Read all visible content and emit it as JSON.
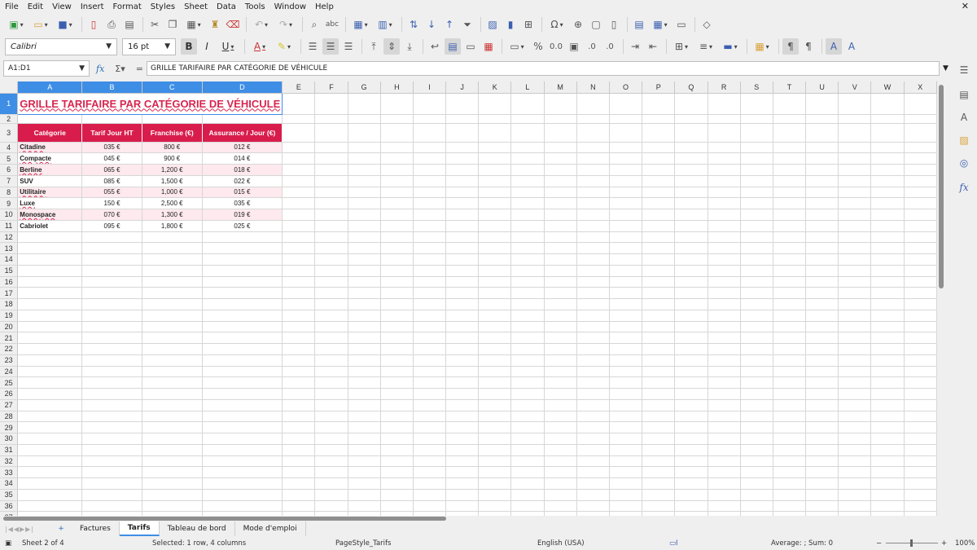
{
  "menu": [
    "File",
    "Edit",
    "View",
    "Insert",
    "Format",
    "Styles",
    "Sheet",
    "Data",
    "Tools",
    "Window",
    "Help"
  ],
  "window_close": "✕",
  "toolbar": {
    "font_name": "Calibri",
    "font_size": "16 pt"
  },
  "formula_bar": {
    "cell_ref": "A1:D1",
    "content": "GRILLE TARIFAIRE PAR CATÉGORIE DE VÉHICULE"
  },
  "columns": [
    "A",
    "B",
    "C",
    "D",
    "E",
    "F",
    "G",
    "H",
    "I",
    "J",
    "K",
    "L",
    "M",
    "N",
    "O",
    "P",
    "Q",
    "R",
    "S",
    "T",
    "U",
    "V",
    "W",
    "X"
  ],
  "sheet": {
    "title": "GRILLE TARIFAIRE PAR CATÉGORIE DE VÉHICULE",
    "headers": [
      "Catégorie",
      "Tarif Jour HT",
      "Franchise (€)",
      "Assurance / Jour (€)"
    ],
    "rows": [
      [
        "Citadine",
        "035 €",
        "800 €",
        "012 €"
      ],
      [
        "Compacte",
        "045 €",
        "900 €",
        "014 €"
      ],
      [
        "Berline",
        "065 €",
        "1,200 €",
        "018 €"
      ],
      [
        "SUV",
        "085 €",
        "1,500 €",
        "022 €"
      ],
      [
        "Utilitaire",
        "055 €",
        "1,000 €",
        "015 €"
      ],
      [
        "Luxe",
        "150 €",
        "2,500 €",
        "035 €"
      ],
      [
        "Monospace",
        "070 €",
        "1,300 €",
        "019 €"
      ],
      [
        "Cabriolet",
        "095 €",
        "1,800 €",
        "025 €"
      ]
    ]
  },
  "tabs": [
    "Factures",
    "Tarifs",
    "Tableau de bord",
    "Mode d'emploi"
  ],
  "active_tab": "Tarifs",
  "status": {
    "sheet": "Sheet 2 of 4",
    "selection": "Selected: 1 row, 4 columns",
    "page_style": "PageStyle_Tarifs",
    "language": "English (USA)",
    "summary": "Average: ; Sum: 0",
    "zoom": "100%"
  },
  "colors": {
    "accent": "#3e8ee6",
    "header_fill": "#d81d4c",
    "title_text": "#d7264f",
    "alt_row": "#fde9ee"
  }
}
